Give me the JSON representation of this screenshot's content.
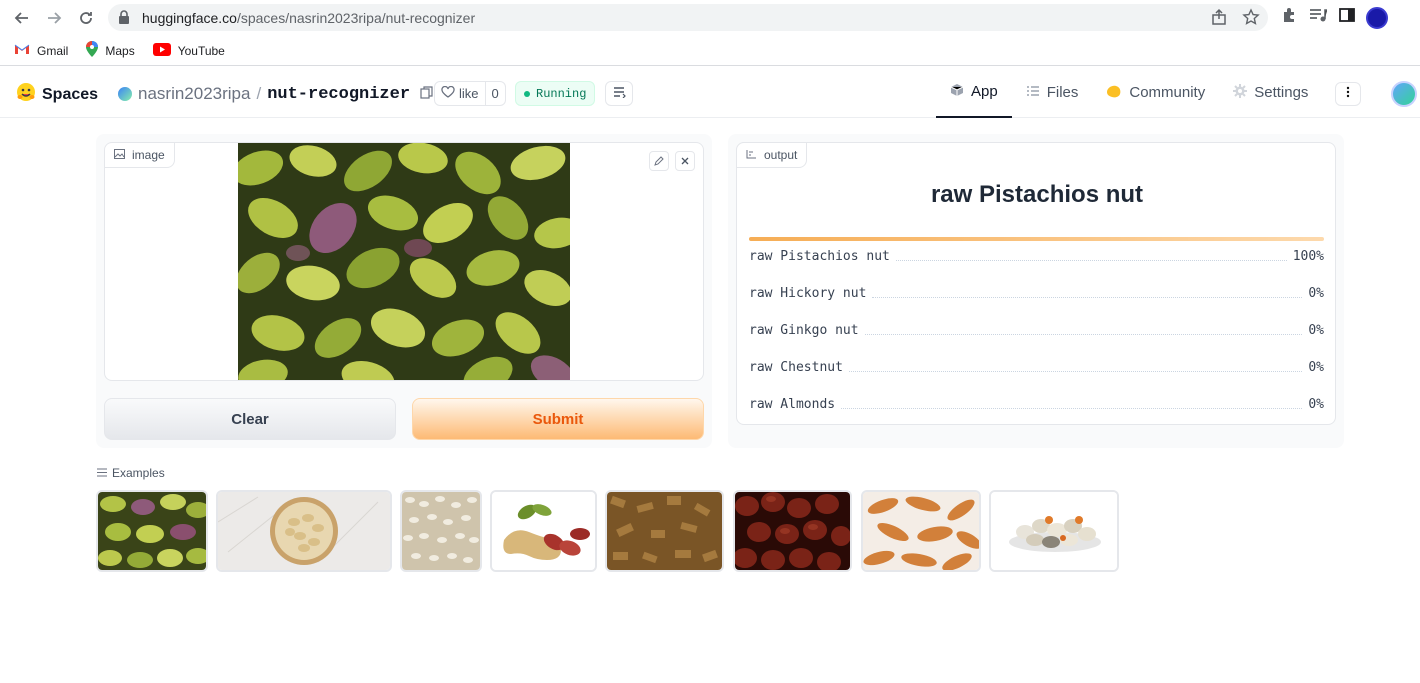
{
  "browser": {
    "url_host": "huggingface.co",
    "url_path": "/spaces/nasrin2023ripa/nut-recognizer",
    "bookmarks": [
      {
        "label": "Gmail",
        "icon": "gmail-icon"
      },
      {
        "label": "Maps",
        "icon": "maps-icon"
      },
      {
        "label": "YouTube",
        "icon": "youtube-icon"
      }
    ]
  },
  "header": {
    "logo_text": "Spaces",
    "owner": "nasrin2023ripa",
    "separator": "/",
    "repo": "nut-recognizer",
    "like_label": "like",
    "like_count": "0",
    "status": "Running",
    "tabs": [
      {
        "label": "App",
        "icon": "cube-icon",
        "active": true
      },
      {
        "label": "Files",
        "icon": "files-icon",
        "active": false
      },
      {
        "label": "Community",
        "icon": "community-icon",
        "active": false
      },
      {
        "label": "Settings",
        "icon": "gear-icon",
        "active": false
      }
    ]
  },
  "input": {
    "label": "image",
    "clear_label": "Clear",
    "submit_label": "Submit"
  },
  "output": {
    "label": "output",
    "prediction": "raw Pistachios nut",
    "top_confidence": 1.0,
    "confidences": [
      {
        "label": "raw Pistachios nut",
        "value": "100%"
      },
      {
        "label": "raw Hickory nut",
        "value": "0%"
      },
      {
        "label": "raw Ginkgo nut",
        "value": "0%"
      },
      {
        "label": "raw Chestnut",
        "value": "0%"
      },
      {
        "label": "raw Almonds",
        "value": "0%"
      }
    ]
  },
  "examples": {
    "label": "Examples",
    "items": [
      "pistachios",
      "cashews",
      "white-seeds",
      "peanuts",
      "walnuts",
      "chestnuts",
      "pine-nuts",
      "mixed-nuts"
    ]
  },
  "colors": {
    "accent_orange": "#ea580c",
    "running_green": "#047857"
  }
}
